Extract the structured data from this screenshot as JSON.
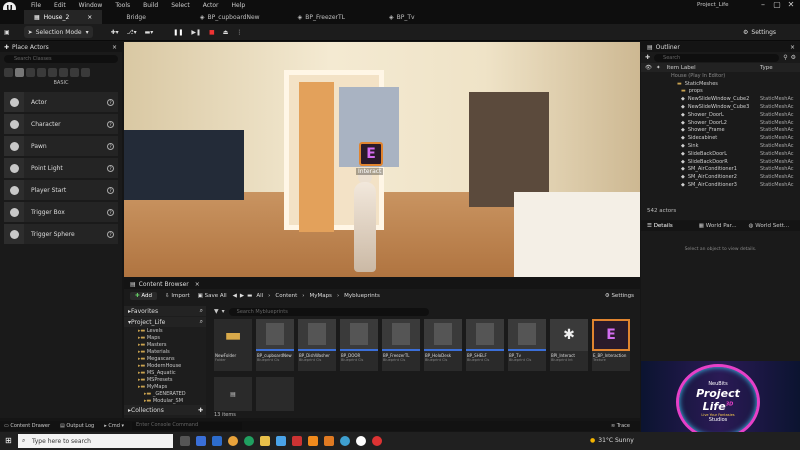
{
  "menu": {
    "items": [
      "File",
      "Edit",
      "Window",
      "Tools",
      "Build",
      "Select",
      "Actor",
      "Help"
    ],
    "project": "Project_Life"
  },
  "tabs": [
    {
      "label": "House_2"
    },
    {
      "label": "Bridge"
    },
    {
      "label": "BP_cupboardNew"
    },
    {
      "label": "BP_FreezerTL"
    },
    {
      "label": "BP_Tv"
    }
  ],
  "toolbar": {
    "mode": "Selection Mode",
    "settings": "Settings"
  },
  "place_actors": {
    "title": "Place Actors",
    "search_placeholder": "Search Classes",
    "category": "BASIC",
    "actors": [
      "Actor",
      "Character",
      "Pawn",
      "Point Light",
      "Player Start",
      "Trigger Box",
      "Trigger Sphere"
    ]
  },
  "viewport": {
    "interact_label": "Interact"
  },
  "outliner": {
    "title": "Outliner",
    "search_placeholder": "Search",
    "col_label": "Item Label",
    "col_type": "Type",
    "root": "House (Play In Editor)",
    "folder1": "StaticMeshes",
    "folder2": "props",
    "rows": [
      {
        "label": "NewSlideWindow_Cube2",
        "type": "StaticMeshAc"
      },
      {
        "label": "NewSlideWindow_Cube3",
        "type": "StaticMeshAc"
      },
      {
        "label": "Shower_DoorL",
        "type": "StaticMeshAc"
      },
      {
        "label": "Shower_DoorL2",
        "type": "StaticMeshAc"
      },
      {
        "label": "Shower_Frame",
        "type": "StaticMeshAc"
      },
      {
        "label": "Sidecabinet",
        "type": "StaticMeshAc"
      },
      {
        "label": "Sink",
        "type": "StaticMeshAc"
      },
      {
        "label": "SlideBackDoorL",
        "type": "StaticMeshAc"
      },
      {
        "label": "SlideBackDoorR",
        "type": "StaticMeshAc"
      },
      {
        "label": "SM_AirConditioner1",
        "type": "StaticMeshAc"
      },
      {
        "label": "SM_AirConditioner2",
        "type": "StaticMeshAc"
      },
      {
        "label": "SM_AirConditioner3",
        "type": "StaticMeshAc"
      }
    ],
    "count": "542 actors"
  },
  "details": {
    "tab1": "Details",
    "tab2": "World Par...",
    "tab3": "World Sett...",
    "empty_msg": "Select an object to view details."
  },
  "ad": {
    "line1": "NeuBits",
    "line2": "Project",
    "line3": "Life",
    "badge": "3D",
    "tagline": "Live Your Fantasies",
    "footer": "Studios"
  },
  "content_browser": {
    "title": "Content Browser",
    "add": "Add",
    "import": "Import",
    "save_all": "Save All",
    "path": [
      "All",
      "Content",
      "MyMaps",
      "Myblueprints"
    ],
    "settings": "Settings",
    "favorites": "Favorites",
    "project": "Project_Life",
    "search_placeholder": "Search Myblueprints",
    "folders": [
      "Levels",
      "Maps",
      "Masters",
      "Materials",
      "Megascans",
      "ModernHouse",
      "MS_Aquatic",
      "MSPresets",
      "MyMaps",
      "_GENERATED",
      "Modular_SM"
    ],
    "collections": "Collections",
    "item_count": "13 items",
    "assets": [
      {
        "name": "NewFolder",
        "type": "Folder"
      },
      {
        "name": "BP_cupboardNew",
        "type": "Blueprint Cls"
      },
      {
        "name": "BP_DishWasher",
        "type": "Blueprint Cls"
      },
      {
        "name": "BP_DOOR",
        "type": "Blueprint Cls"
      },
      {
        "name": "BP_FreezerTL",
        "type": "Blueprint Cls"
      },
      {
        "name": "BP_HoloDesk",
        "type": "Blueprint Cls"
      },
      {
        "name": "BP_SHELF",
        "type": "Blueprint Cls"
      },
      {
        "name": "BP_Tv",
        "type": "Blueprint Cls"
      },
      {
        "name": "BPI_Interact",
        "type": "Blueprint Int"
      },
      {
        "name": "E_BP_Interaction",
        "type": "Texture"
      }
    ]
  },
  "statusbar": {
    "drawer": "Content Drawer",
    "log": "Output Log",
    "cmd": "Cmd",
    "console_placeholder": "Enter Console Command",
    "trace": "Trace"
  },
  "taskbar": {
    "search_placeholder": "Type here to search",
    "weather": "31°C  Sunny"
  }
}
